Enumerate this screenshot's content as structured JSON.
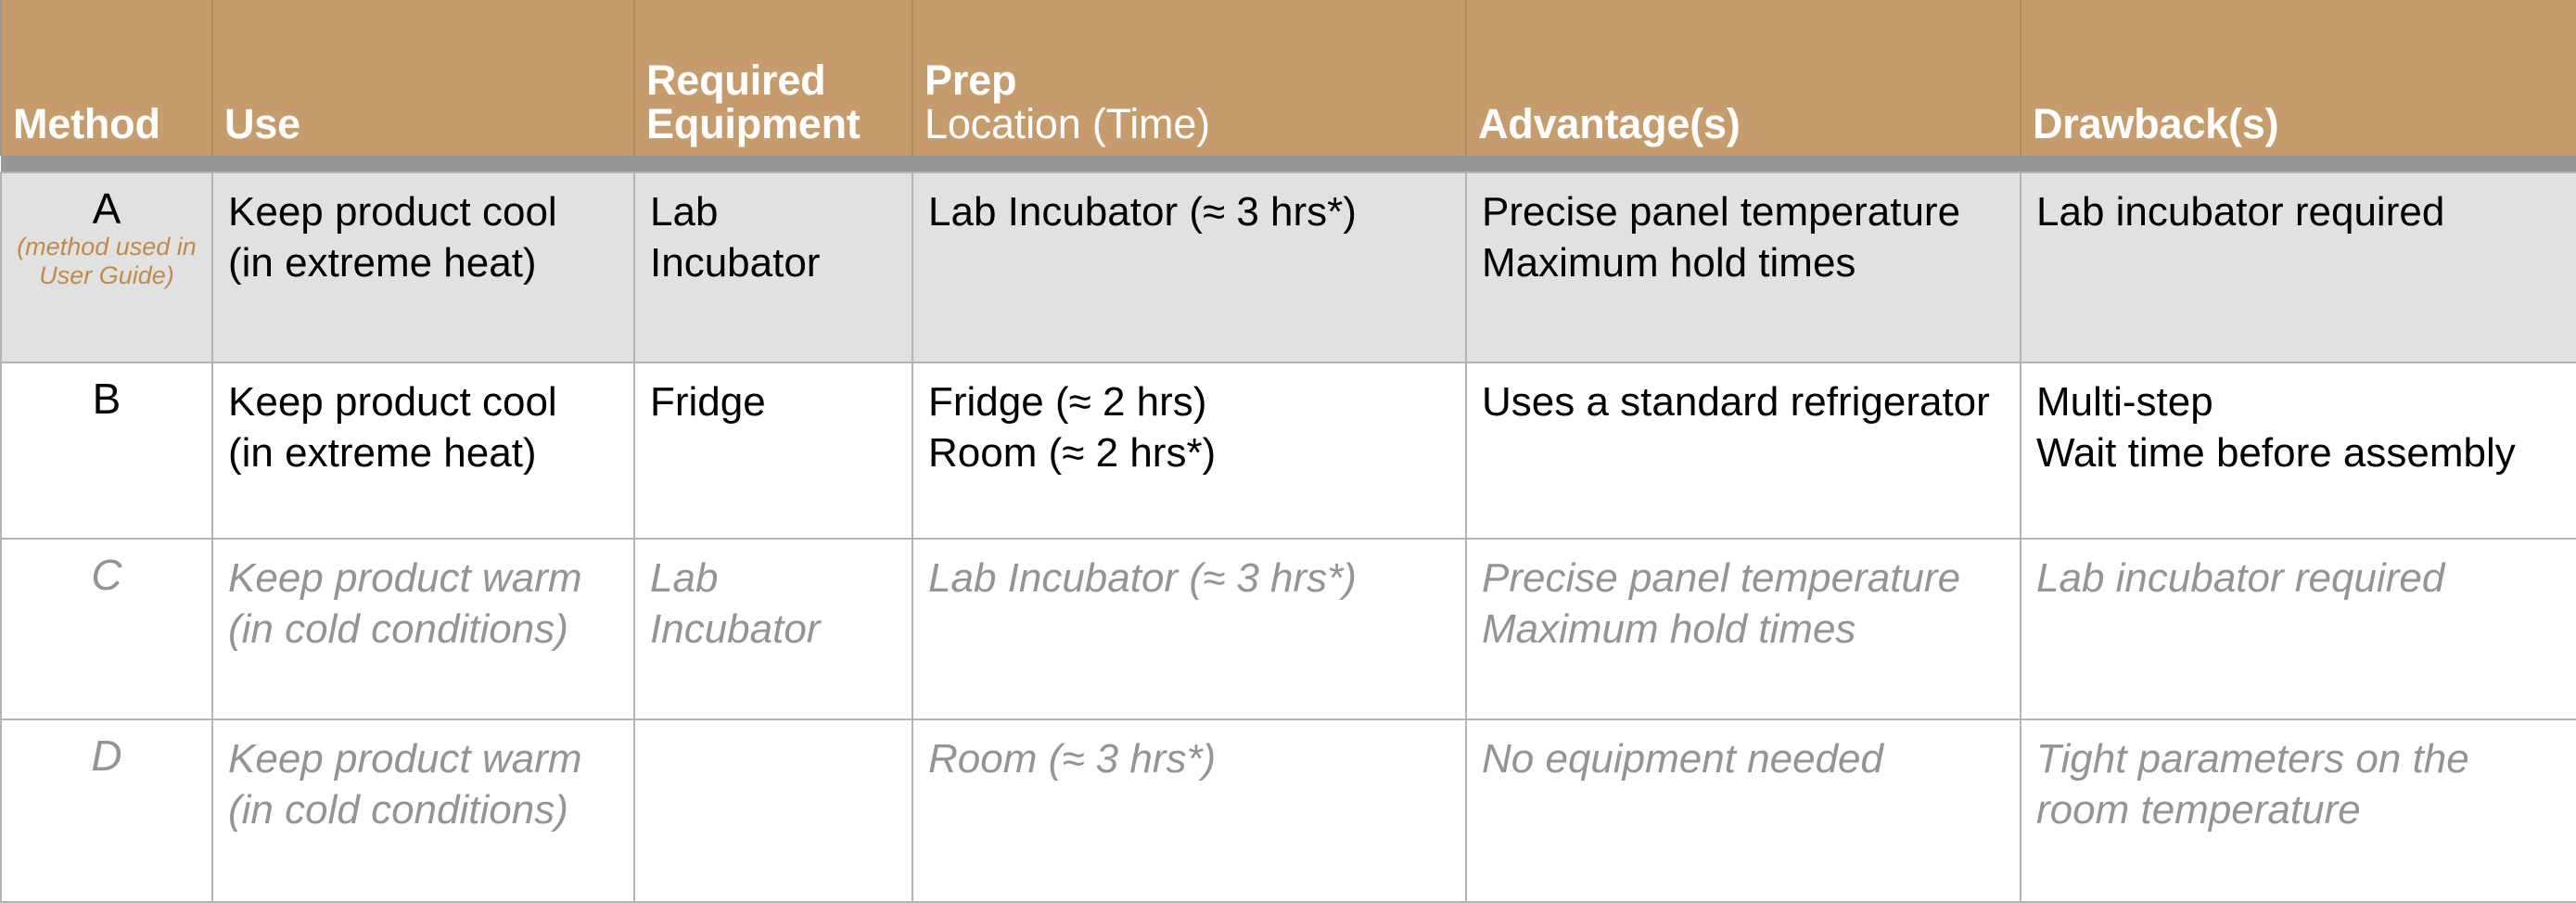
{
  "table": {
    "columns": [
      {
        "id": "method",
        "header_lines": [
          "Method"
        ],
        "bold_lines": [
          true
        ]
      },
      {
        "id": "use",
        "header_lines": [
          "Use"
        ],
        "bold_lines": [
          true
        ]
      },
      {
        "id": "equipment",
        "header_lines": [
          "Required",
          "Equipment"
        ],
        "bold_lines": [
          true,
          true
        ]
      },
      {
        "id": "prep",
        "header_lines": [
          "Prep",
          "Location (Time)"
        ],
        "bold_lines": [
          true,
          false
        ]
      },
      {
        "id": "advantage",
        "header_lines": [
          "Advantage(s)"
        ],
        "bold_lines": [
          true
        ]
      },
      {
        "id": "drawback",
        "header_lines": [
          "Drawback(s)"
        ],
        "bold_lines": [
          true
        ]
      }
    ],
    "header_text": {
      "method": "Method",
      "use": "Use",
      "equipment_line1": "Required",
      "equipment_line2": "Equipment",
      "prep_line1": "Prep",
      "prep_line2": "Location (Time)",
      "advantage": "Advantage(s)",
      "drawback": "Drawback(s)"
    },
    "rows": [
      {
        "id": "row-a",
        "highlighted": true,
        "dimmed": false,
        "method_letter": "A",
        "method_note_line1": "(method used in",
        "method_note_line2": "User Guide)",
        "use_line1": "Keep product cool",
        "use_line2": "(in extreme heat)",
        "equipment_line1": "Lab",
        "equipment_line2": "Incubator",
        "prep_line1": "Lab Incubator (≈ 3 hrs*)",
        "prep_line2": "",
        "advantage_line1": "Precise panel temperature",
        "advantage_line2": "Maximum hold times",
        "drawback_line1": "Lab incubator required",
        "drawback_line2": ""
      },
      {
        "id": "row-b",
        "highlighted": false,
        "dimmed": false,
        "method_letter": "B",
        "method_note_line1": "",
        "method_note_line2": "",
        "use_line1": "Keep product cool",
        "use_line2": "(in extreme heat)",
        "equipment_line1": "Fridge",
        "equipment_line2": "",
        "prep_line1": "Fridge (≈ 2 hrs)",
        "prep_line2": "Room (≈ 2 hrs*)",
        "advantage_line1": "Uses a standard refrigerator",
        "advantage_line2": "",
        "drawback_line1": "Multi-step",
        "drawback_line2": "Wait time before assembly"
      },
      {
        "id": "row-c",
        "highlighted": false,
        "dimmed": true,
        "method_letter": "C",
        "method_note_line1": "",
        "method_note_line2": "",
        "use_line1": "Keep product warm",
        "use_line2": "(in cold conditions)",
        "equipment_line1": "Lab",
        "equipment_line2": "Incubator",
        "prep_line1": "Lab Incubator (≈ 3 hrs*)",
        "prep_line2": "",
        "advantage_line1": "Precise panel temperature",
        "advantage_line2": "Maximum hold times",
        "drawback_line1": "Lab incubator required",
        "drawback_line2": ""
      },
      {
        "id": "row-d",
        "highlighted": false,
        "dimmed": true,
        "method_letter": "D",
        "method_note_line1": "",
        "method_note_line2": "",
        "use_line1": "Keep product warm",
        "use_line2": "(in cold conditions)",
        "equipment_line1": "",
        "equipment_line2": "",
        "prep_line1": "Room (≈ 3 hrs*)",
        "prep_line2": "",
        "advantage_line1": "No equipment needed",
        "advantage_line2": "",
        "drawback_line1": "Tight parameters on the",
        "drawback_line2": "room temperature"
      }
    ]
  },
  "colors": {
    "header_background": "#c69c6d",
    "header_text": "#ffffff",
    "header_rule": "#969696",
    "highlight_row_background": "#e1e1e1",
    "body_text": "#000000",
    "dimmed_text": "#949494",
    "method_note_text": "#c08b4a",
    "cell_border": "#b4b4b4",
    "page_background": "#ffffff"
  }
}
